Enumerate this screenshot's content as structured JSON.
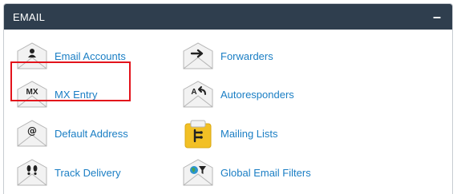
{
  "panel": {
    "title": "EMAIL",
    "collapse_symbol": "–"
  },
  "items": [
    {
      "label": "Email Accounts",
      "icon": "user-envelope-icon"
    },
    {
      "label": "Forwarders",
      "icon": "arrow-envelope-icon"
    },
    {
      "label": "MX Entry",
      "icon": "mx-envelope-icon"
    },
    {
      "label": "Autoresponders",
      "icon": "reply-envelope-icon"
    },
    {
      "label": "Default Address",
      "icon": "at-envelope-icon"
    },
    {
      "label": "Mailing Lists",
      "icon": "list-envelope-icon"
    },
    {
      "label": "Track Delivery",
      "icon": "footprints-envelope-icon"
    },
    {
      "label": "Global Email Filters",
      "icon": "globe-filter-envelope-icon"
    }
  ],
  "colors": {
    "header_bg": "#2f3e4e",
    "link": "#1a7ec4",
    "highlight": "#e3131b",
    "mailing_lists_accent": "#f2c025"
  }
}
